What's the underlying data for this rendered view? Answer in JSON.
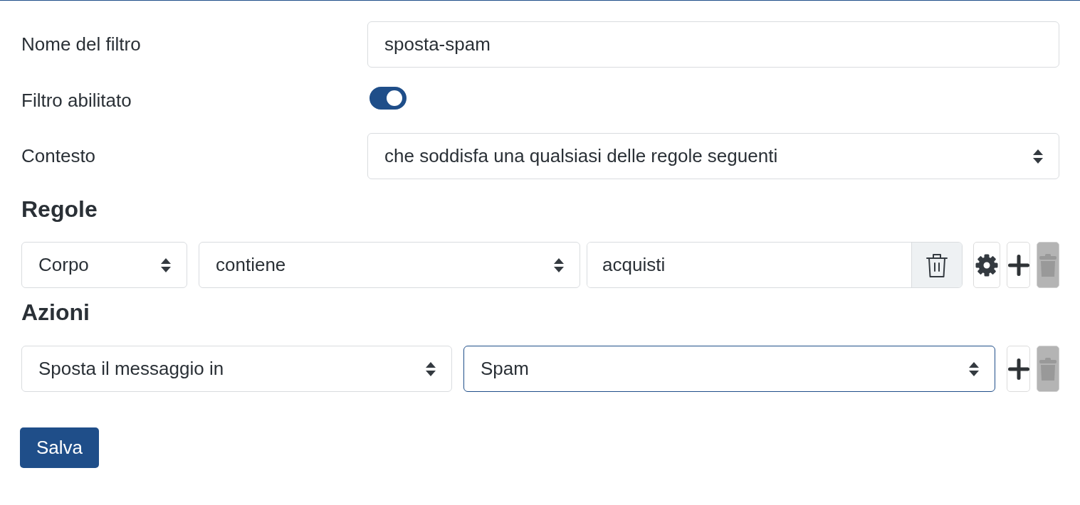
{
  "fields": [
    {
      "kind": "text",
      "label": "Nome del filtro",
      "value": "sposta-spam"
    },
    {
      "kind": "toggle",
      "label": "Filtro abilitato",
      "on": true
    },
    {
      "kind": "select",
      "label": "Contesto",
      "value": "che soddisfa una qualsiasi delle regole seguenti"
    }
  ],
  "rules": {
    "heading": "Regole",
    "rows": [
      {
        "field": "Corpo",
        "operator": "contiene",
        "value": "acquisti",
        "remove_disabled": true
      }
    ]
  },
  "actions": {
    "heading": "Azioni",
    "rows": [
      {
        "action": "Sposta il messaggio in",
        "target": "Spam",
        "target_focused": true,
        "remove_disabled": true
      }
    ]
  },
  "save_button": {
    "label": "Salva"
  }
}
